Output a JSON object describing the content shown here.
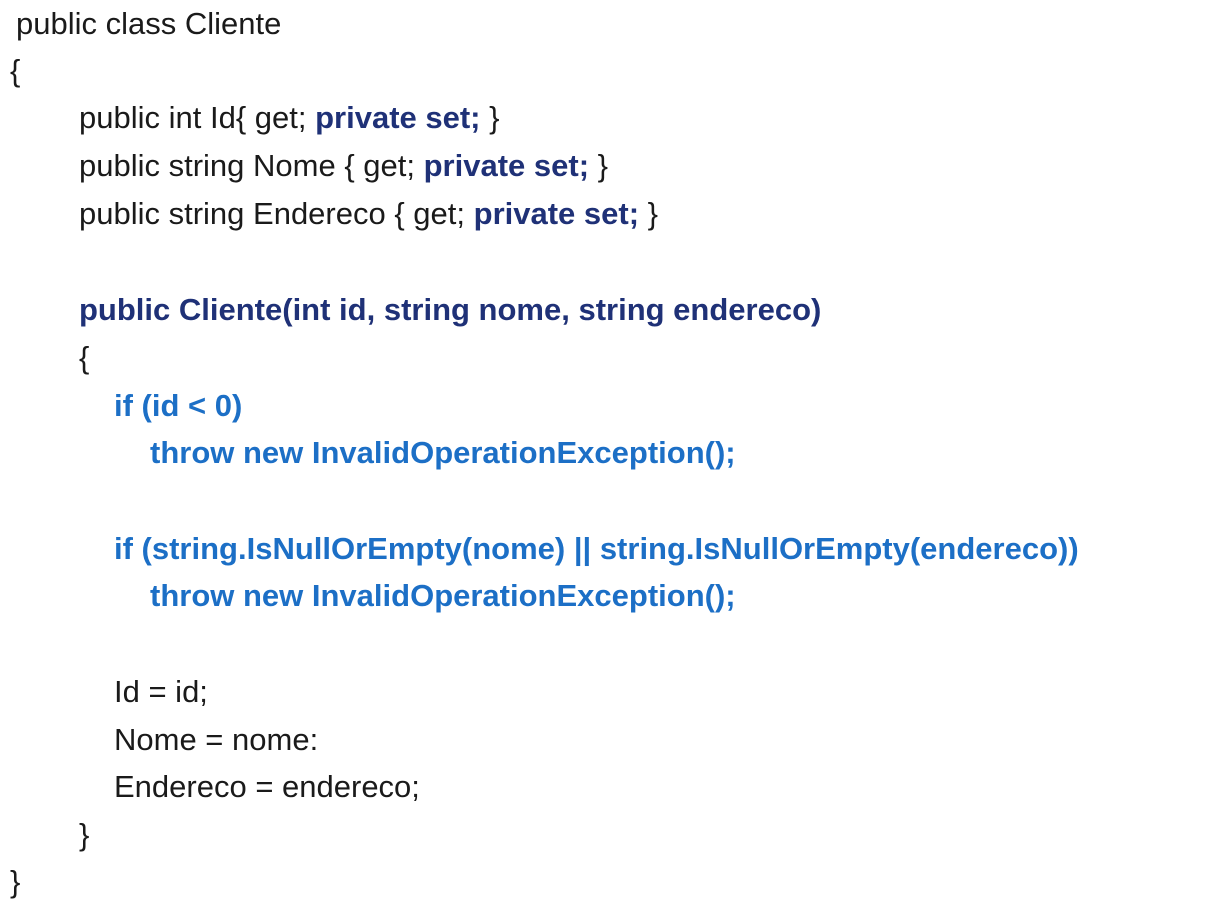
{
  "colors": {
    "text": "#1a1a1a",
    "highlight_dark": "#1f3177",
    "highlight_blue": "#1c6fc6",
    "background": "#ffffff"
  },
  "code": {
    "l01": "public class Cliente",
    "l02": "{",
    "l03_a": "public int Id{ get; ",
    "l03_b": "private set;",
    "l03_c": " }",
    "l04_a": "public string Nome { get; ",
    "l04_b": "private set;",
    "l04_c": " }",
    "l05_a": "public string Endereco { get; ",
    "l05_b": "private set;",
    "l05_c": " }",
    "l06": "public Cliente(int id, string nome, string endereco)",
    "l07": "{",
    "l08": "if (id < 0)",
    "l09": "throw new InvalidOperationException();",
    "l10": "if (string.IsNullOrEmpty(nome) || string.IsNullOrEmpty(endereco))",
    "l11": "throw new InvalidOperationException();",
    "l12": "Id = id;",
    "l13": "Nome = nome:",
    "l14": "Endereco = endereco;",
    "l15": "}",
    "l16": "}"
  }
}
